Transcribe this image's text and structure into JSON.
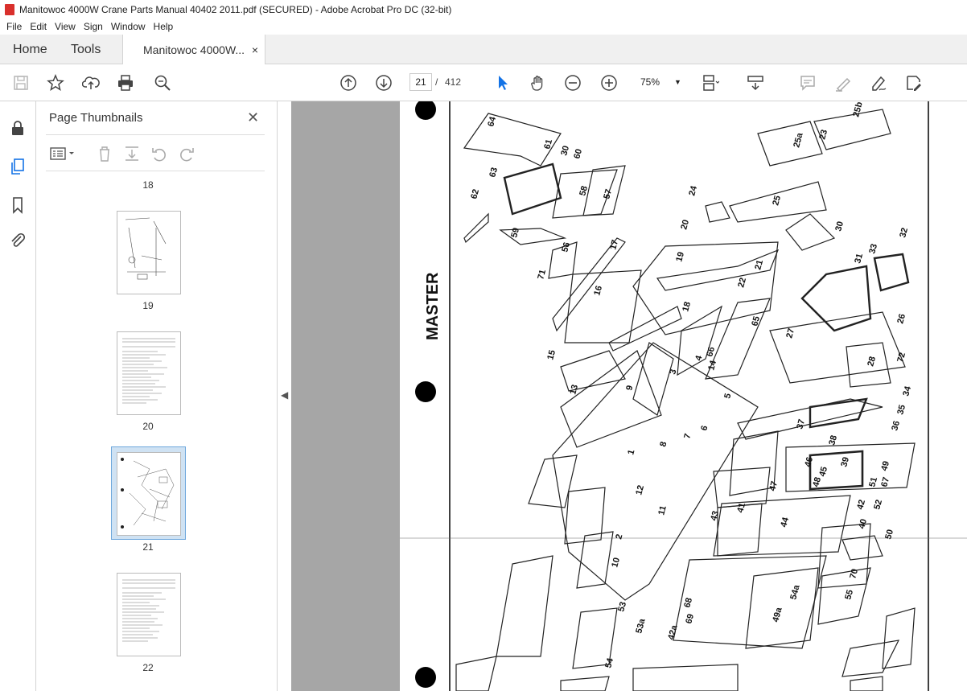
{
  "window": {
    "title": "Manitowoc 4000W Crane Parts Manual 40402 2011.pdf (SECURED) - Adobe Acrobat Pro DC (32-bit)"
  },
  "menu": {
    "items": [
      "File",
      "Edit",
      "View",
      "Sign",
      "Window",
      "Help"
    ]
  },
  "tabs": {
    "home": "Home",
    "tools": "Tools",
    "doc": "Manitowoc 4000W...",
    "close": "×"
  },
  "toolbar": {
    "current_page": "21",
    "page_sep": "/",
    "total_pages": "412",
    "zoom": "75%"
  },
  "panel": {
    "title": "Page Thumbnails",
    "close": "✕",
    "thumbnails": [
      "18",
      "19",
      "20",
      "21",
      "22"
    ],
    "selected": "21"
  },
  "drawing": {
    "master_label": "MASTER",
    "part_numbers": [
      "64",
      "61",
      "30",
      "60",
      "63",
      "62",
      "58",
      "57",
      "59",
      "56",
      "71",
      "17",
      "16",
      "15",
      "13",
      "9",
      "3",
      "4",
      "66",
      "12",
      "11",
      "2",
      "10",
      "53",
      "54",
      "53a",
      "1",
      "7",
      "8",
      "6",
      "5",
      "14",
      "65",
      "18",
      "19",
      "22",
      "21",
      "20",
      "24",
      "25",
      "25a",
      "25b",
      "23",
      "30",
      "31",
      "33",
      "32",
      "26",
      "27",
      "28",
      "72",
      "34",
      "35",
      "36",
      "37",
      "38",
      "45",
      "46",
      "47",
      "48",
      "44",
      "43",
      "41",
      "40",
      "39",
      "52",
      "51",
      "50",
      "49",
      "42",
      "67",
      "68",
      "69",
      "42a",
      "49a",
      "54a",
      "70",
      "55"
    ]
  },
  "colors": {
    "accent": "#1473e6",
    "pdf_red": "#d9302c",
    "viewer_bg": "#a6a6a6",
    "selected_thumb": "#cfe2f3"
  }
}
